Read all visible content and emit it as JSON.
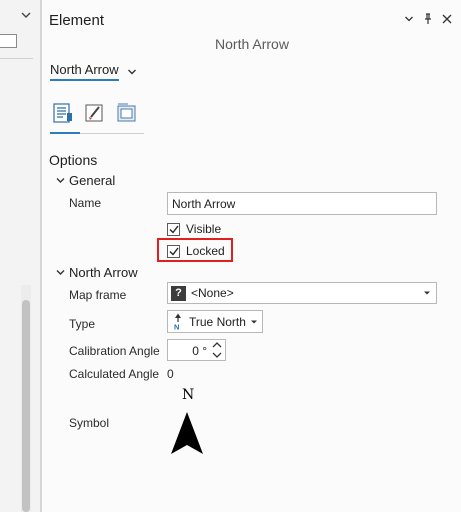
{
  "pane": {
    "title": "Element",
    "element_name": "North Arrow",
    "selector_label": "North Arrow"
  },
  "tabs": [
    {
      "name": "properties",
      "active": true
    },
    {
      "name": "symbol",
      "active": false
    },
    {
      "name": "display",
      "active": false
    }
  ],
  "options": {
    "heading": "Options",
    "general": {
      "heading": "General",
      "name_label": "Name",
      "name_value": "North Arrow",
      "visible_label": "Visible",
      "visible_checked": true,
      "locked_label": "Locked",
      "locked_checked": true
    },
    "north_arrow": {
      "heading": "North Arrow",
      "map_frame_label": "Map frame",
      "map_frame_value": "<None>",
      "type_label": "Type",
      "type_value": "True North",
      "calibration_label": "Calibration Angle",
      "calibration_value": "0 °",
      "calculated_label": "Calculated Angle",
      "calculated_value": "0",
      "symbol_label": "Symbol",
      "symbol_letter": "N"
    }
  },
  "colors": {
    "accent": "#2f7bbf",
    "highlight": "#e0201f"
  }
}
